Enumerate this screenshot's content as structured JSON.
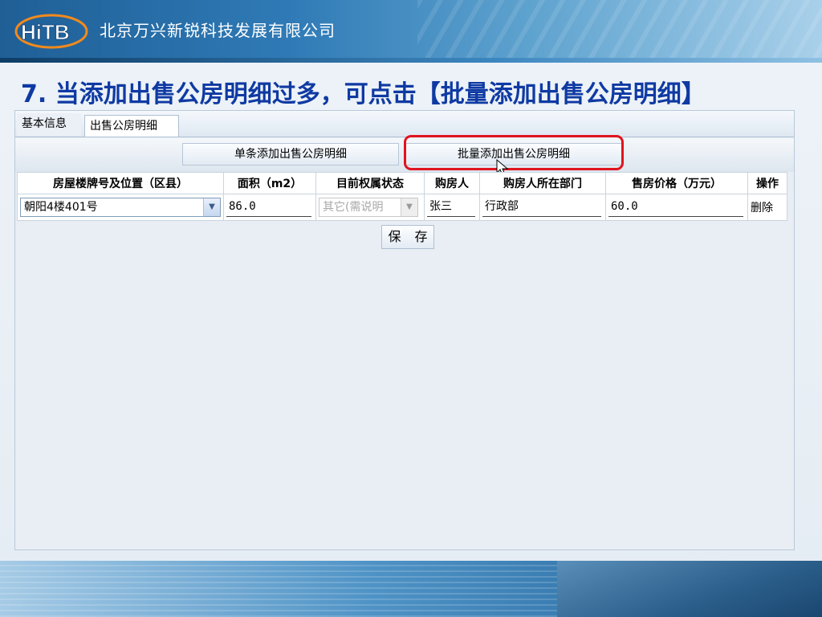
{
  "header": {
    "logo_text": "HiTB",
    "company": "北京万兴新锐科技发展有限公司"
  },
  "slide": {
    "title": "7. 当添加出售公房明细过多，可点击【批量添加出售公房明细】"
  },
  "tabs": [
    {
      "label": "基本信息"
    },
    {
      "label": "出售公房明细"
    }
  ],
  "buttons": {
    "single_add": "单条添加出售公房明细",
    "batch_add": "批量添加出售公房明细",
    "save": "保 存"
  },
  "table": {
    "headers": [
      "房屋楼牌号及位置（区县）",
      "面积（m2）",
      "目前权属状态",
      "购房人",
      "购房人所在部门",
      "售房价格（万元）",
      "操作"
    ],
    "rows": [
      {
        "location": "朝阳4楼401号",
        "area": "86.0",
        "status": "其它(需说明",
        "buyer": "张三",
        "department": "行政部",
        "price": "60.0",
        "action": "删除"
      }
    ]
  },
  "colors": {
    "title": "#0f3aa3",
    "highlight": "#e0141e"
  }
}
